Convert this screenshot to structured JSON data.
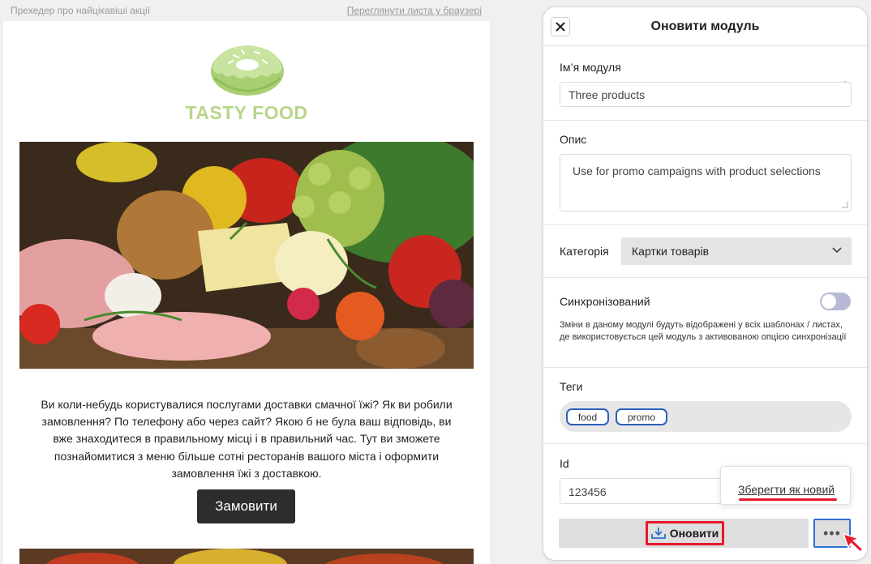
{
  "email": {
    "preheader": "Прехедер про найцікавіші акції",
    "view_in_browser": "Переглянути листа у браузері",
    "logo_text": "TASTY FOOD",
    "body_text": "Ви коли-небудь користувалися послугами доставки смачної їжі? Як ви робили замовлення? По телефону або через сайт? Якою б не була ваш відповідь, ви вже знаходитеся в правильному місці і в правильний час. Тут ви зможете познайомитися з меню більше сотні ресторанів вашого міста і оформити замовлення їжі з доставкою.",
    "order_button": "Замовити"
  },
  "panel": {
    "title": "Оновити модуль",
    "close_icon": "close-icon",
    "module_name_label": "Ім’я модуля",
    "module_name_value": "Three products",
    "required_mark": "*",
    "description_label": "Опис",
    "description_value": "Use for promo campaigns with product selections",
    "category_label": "Категорія",
    "category_value": "Картки товарів",
    "synced_label": "Синхронізований",
    "synced_on": false,
    "synced_hint": "Зміни в даному модулі будуть відображені у всіх шаблонах / листах, де використовується цей модуль з активованою опцією синхронізації",
    "tags_label": "Теги",
    "tags": [
      "food",
      "promo"
    ],
    "id_label": "Id",
    "id_value": "123456",
    "update_button": "Оновити",
    "more_button": "•••",
    "dropdown_item": "Зберегти як новий"
  },
  "colors": {
    "accent_blue": "#2f6fd1",
    "highlight_red": "#e8182c",
    "logo_green": "#b7d68a",
    "button_dark": "#2d2d2d"
  }
}
